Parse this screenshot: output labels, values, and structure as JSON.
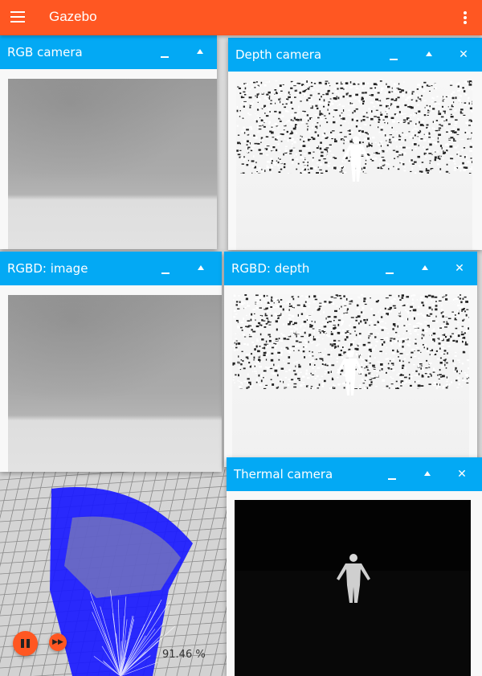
{
  "app": {
    "title": "Gazebo"
  },
  "panels": {
    "rgb_camera": {
      "title": "RGB camera"
    },
    "depth_camera": {
      "title": "Depth camera",
      "close": "✕"
    },
    "rgbd_image": {
      "title": "RGBD: image"
    },
    "rgbd_depth": {
      "title": "RGBD: depth",
      "close": "✕"
    },
    "thermal_camera": {
      "title": "Thermal camera",
      "close": "✕"
    }
  },
  "controls": {
    "real_time_factor": "91.46 %",
    "pause_icon": "pause-icon",
    "step_icon": "fast-forward-icon"
  },
  "colors": {
    "app_bar": "#ff5722",
    "panel_header": "#03a9f4",
    "lidar_rays": "#1a1aff"
  }
}
